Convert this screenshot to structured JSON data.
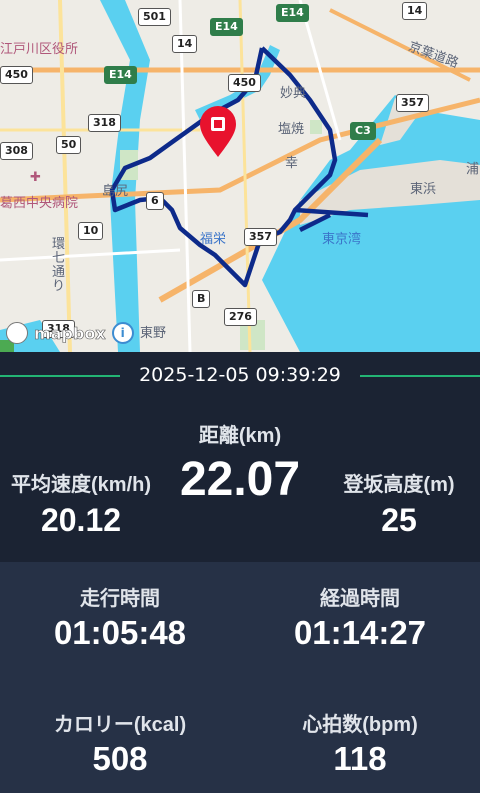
{
  "map": {
    "places": {
      "edogawa_ward_office": "江戸川区役所",
      "keiyo_road": "京葉道路",
      "myoden": "妙典",
      "shioyaki": "塩焼",
      "saiwai": "幸",
      "shinohara": "島尻",
      "fukuei": "福栄",
      "tokyo_bay": "東京湾",
      "higashihama": "東浜",
      "hospital": "葛西中央病院",
      "kan7": "環七通り",
      "higashino": "東野",
      "ura": "浦"
    },
    "road_shields": [
      "501",
      "14",
      "E14",
      "E14",
      "14",
      "E14",
      "450",
      "450",
      "318",
      "50",
      "357",
      "C3",
      "6",
      "10",
      "357",
      "B",
      "276",
      "308",
      "318"
    ],
    "attribution": "mapbox",
    "route_color": "#0d2a8a",
    "pin_color": "#e8122d"
  },
  "activity": {
    "datetime": "2025-12-05 09:39:29",
    "distance_label": "距離(km)",
    "distance_value": "22.07",
    "avg_speed_label": "平均速度(km/h)",
    "avg_speed_value": "20.12",
    "elevation_label": "登坂高度(m)",
    "elevation_value": "25",
    "moving_time_label": "走行時間",
    "moving_time_value": "01:05:48",
    "elapsed_time_label": "経過時間",
    "elapsed_time_value": "01:14:27",
    "calories_label": "カロリー(kcal)",
    "calories_value": "508",
    "heart_rate_label": "心拍数(bpm)",
    "heart_rate_value": "118"
  },
  "colors": {
    "accent_line": "#23b574",
    "panel_dark": "#1b2333",
    "panel_light": "#263146"
  }
}
